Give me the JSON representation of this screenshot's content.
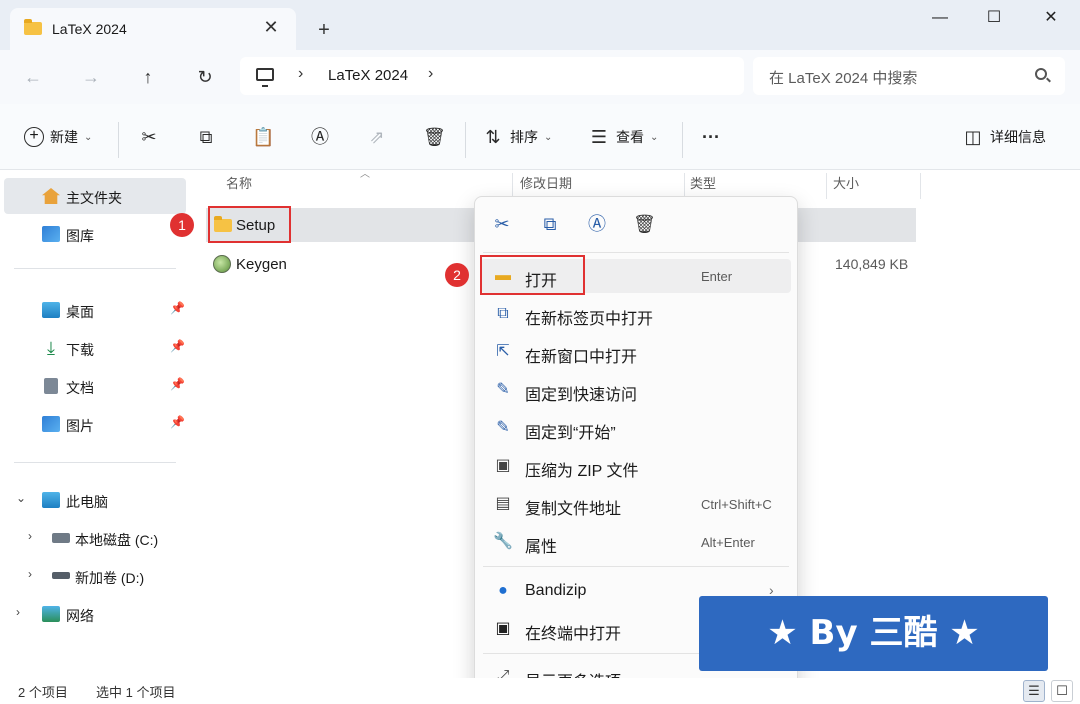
{
  "window": {
    "tab_title": "LaTeX 2024",
    "tab_close": "✕",
    "new_tab": "+",
    "minimize": "—",
    "maximize": "☐",
    "close": "✕"
  },
  "nav": {
    "back": "←",
    "forward": "→",
    "up": "↑",
    "refresh": "↻",
    "breadcrumb_sep1": "›",
    "breadcrumb": "LaTeX 2024",
    "breadcrumb_sep2": "›",
    "search_placeholder": "在 LaTeX 2024 中搜索"
  },
  "toolbar": {
    "new_label": "新建",
    "sort_label": "排序",
    "view_label": "查看",
    "more": "···",
    "details_label": "详细信息"
  },
  "sidebar": {
    "home": "主文件夹",
    "gallery": "图库",
    "desktop": "桌面",
    "downloads": "下载",
    "documents": "文档",
    "pictures": "图片",
    "this_pc": "此电脑",
    "disk_c": "本地磁盘 (C:)",
    "disk_d": "新加卷 (D:)",
    "network": "网络"
  },
  "columns": {
    "name": "名称",
    "modified": "修改日期",
    "type": "类型",
    "size": "大小"
  },
  "files": [
    {
      "name": "Setup",
      "size": ""
    },
    {
      "name": "Keygen",
      "size": "140,849 KB"
    }
  ],
  "annotations": {
    "step1": "1",
    "step2": "2"
  },
  "context_menu": {
    "items": [
      {
        "label": "打开",
        "shortcut": "Enter"
      },
      {
        "label": "在新标签页中打开",
        "shortcut": ""
      },
      {
        "label": "在新窗口中打开",
        "shortcut": ""
      },
      {
        "label": "固定到快速访问",
        "shortcut": ""
      },
      {
        "label": "固定到“开始”",
        "shortcut": ""
      },
      {
        "label": "压缩为 ZIP 文件",
        "shortcut": ""
      },
      {
        "label": "复制文件地址",
        "shortcut": "Ctrl+Shift+C"
      },
      {
        "label": "属性",
        "shortcut": "Alt+Enter"
      },
      {
        "label": "Bandizip",
        "shortcut": ""
      },
      {
        "label": "在终端中打开",
        "shortcut": ""
      },
      {
        "label": "显示更多选项",
        "shortcut": ""
      }
    ]
  },
  "status": {
    "item_count": "2 个项目",
    "selected": "选中 1 个项目"
  },
  "watermark": "★ By 三酷 ★",
  "colors": {
    "accent": "#2a5ea8",
    "highlight_red": "#e03131",
    "banner_blue": "#2e69c0"
  }
}
